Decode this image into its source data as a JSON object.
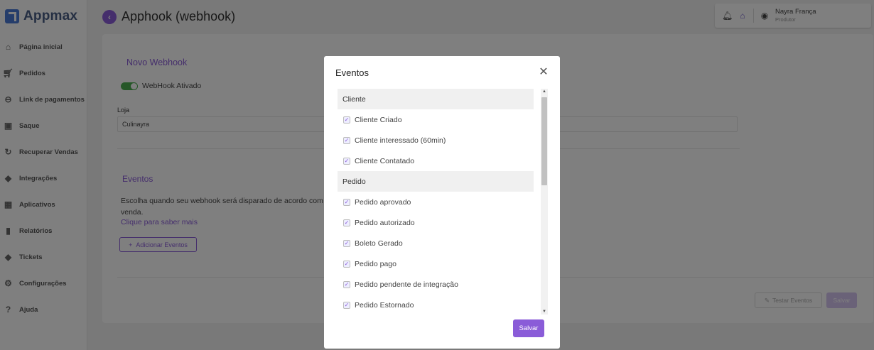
{
  "app": {
    "logo_text": "Appmax"
  },
  "sidebar": {
    "items": [
      {
        "label": "Página inicial",
        "icon": "home-icon"
      },
      {
        "label": "Pedidos",
        "icon": "cart-icon"
      },
      {
        "label": "Link de pagamentos",
        "icon": "link-icon"
      },
      {
        "label": "Saque",
        "icon": "money-icon"
      },
      {
        "label": "Recuperar Vendas",
        "icon": "recover-icon"
      },
      {
        "label": "Integrações",
        "icon": "puzzle-icon"
      },
      {
        "label": "Aplicativos",
        "icon": "apps-icon"
      },
      {
        "label": "Relatórios",
        "icon": "bar-chart-icon"
      },
      {
        "label": "Tickets",
        "icon": "ticket-icon"
      },
      {
        "label": "Configurações",
        "icon": "gear-icon"
      },
      {
        "label": "Ajuda",
        "icon": "help-icon"
      }
    ]
  },
  "header": {
    "title": "Apphook (webhook)",
    "user": {
      "name": "Nayra França",
      "role": "Produtor"
    }
  },
  "form": {
    "title": "Novo Webhook",
    "toggle_label": "WebHook Ativado",
    "toggle_on": true,
    "loja_label": "Loja",
    "loja_value": "Culinayra",
    "eventos_title": "Eventos",
    "eventos_desc": "Escolha quando seu webhook será disparado de acordo com",
    "eventos_desc2": "venda.",
    "saber_link": "Clique para saber mais",
    "add_button": "Adicionar Eventos",
    "testar_button": "Testar Eventos",
    "salvar_button": "Salvar"
  },
  "modal": {
    "title": "Eventos",
    "groups": [
      {
        "name": "Cliente",
        "items": [
          {
            "label": "Cliente Criado",
            "checked": true
          },
          {
            "label": "Cliente interessado (60min)",
            "checked": true
          },
          {
            "label": "Cliente Contatado",
            "checked": true
          }
        ]
      },
      {
        "name": "Pedido",
        "items": [
          {
            "label": "Pedido aprovado",
            "checked": true
          },
          {
            "label": "Pedido autorizado",
            "checked": true
          },
          {
            "label": "Boleto Gerado",
            "checked": true
          },
          {
            "label": "Pedido pago",
            "checked": true
          },
          {
            "label": "Pedido pendente de integração",
            "checked": true
          },
          {
            "label": "Pedido Estornado",
            "checked": true
          }
        ]
      }
    ],
    "save_button": "Salvar"
  },
  "colors": {
    "accent": "#8a5cd8",
    "toggle_on": "#4caf50"
  }
}
